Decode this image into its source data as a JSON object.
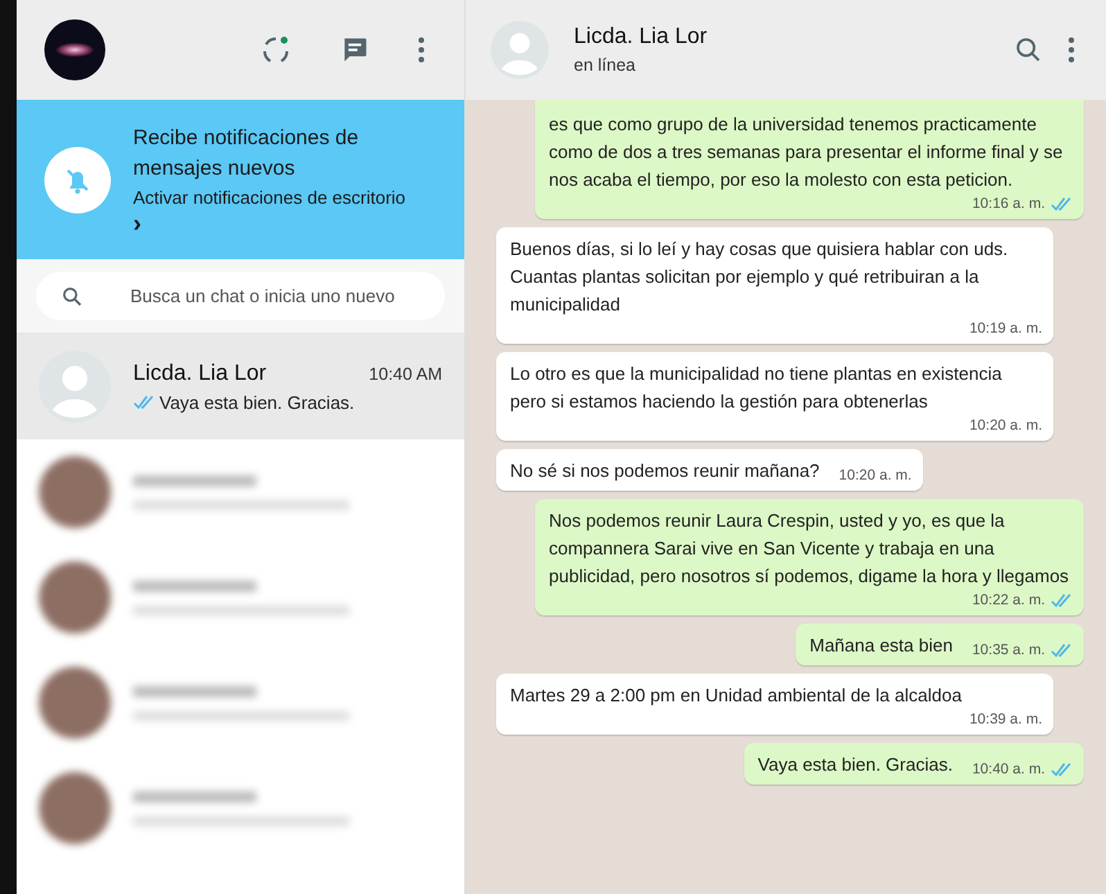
{
  "sidebar": {
    "notification_banner": {
      "title": "Recibe notificaciones de mensajes nuevos",
      "link": "Activar notificaciones de escritorio",
      "chevron": "›"
    },
    "search": {
      "placeholder": "Busca un chat o inicia uno nuevo"
    },
    "chats": [
      {
        "name": "Licda. Lia Lor",
        "time": "10:40 AM",
        "preview": "Vaya esta bien. Gracias.",
        "read": true,
        "selected": true
      }
    ]
  },
  "conversation": {
    "contact": {
      "name": "Licda. Lia Lor",
      "status": "en línea"
    },
    "messages": [
      {
        "kind": "out",
        "text": "es que como grupo de la universidad tenemos practicamente como de dos a tres semanas para presentar el informe final y se nos acaba el tiempo, por eso la molesto con esta peticion.",
        "time": "10:16 a. m.",
        "read": true
      },
      {
        "kind": "in",
        "text": "Buenos días,  si lo leí y hay cosas que quisiera hablar con uds. Cuantas plantas solicitan por ejemplo y qué retribuiran a la municipalidad",
        "time": "10:19 a. m."
      },
      {
        "kind": "in",
        "text": "Lo otro es que la municipalidad no tiene plantas en existencia pero si estamos haciendo la gestión para obtenerlas",
        "time": "10:20 a. m."
      },
      {
        "kind": "in",
        "text": "No sé si nos podemos reunir mañana?",
        "time": "10:20 a. m."
      },
      {
        "kind": "out",
        "text": "Nos podemos reunir Laura Crespin, usted y yo, es que la compannera Sarai vive en San Vicente y trabaja en una publicidad, pero nosotros sí podemos, digame la hora y llegamos",
        "time": "10:22 a. m.",
        "read": true
      },
      {
        "kind": "out",
        "text": "Mañana esta bien",
        "time": "10:35 a. m.",
        "read": true
      },
      {
        "kind": "in",
        "text": "Martes 29 a 2:00 pm en Unidad ambiental de la alcaldoa",
        "time": "10:39 a. m."
      },
      {
        "kind": "out",
        "text": "Vaya esta bien. Gracias.",
        "time": "10:40 a. m.",
        "read": true
      }
    ]
  }
}
